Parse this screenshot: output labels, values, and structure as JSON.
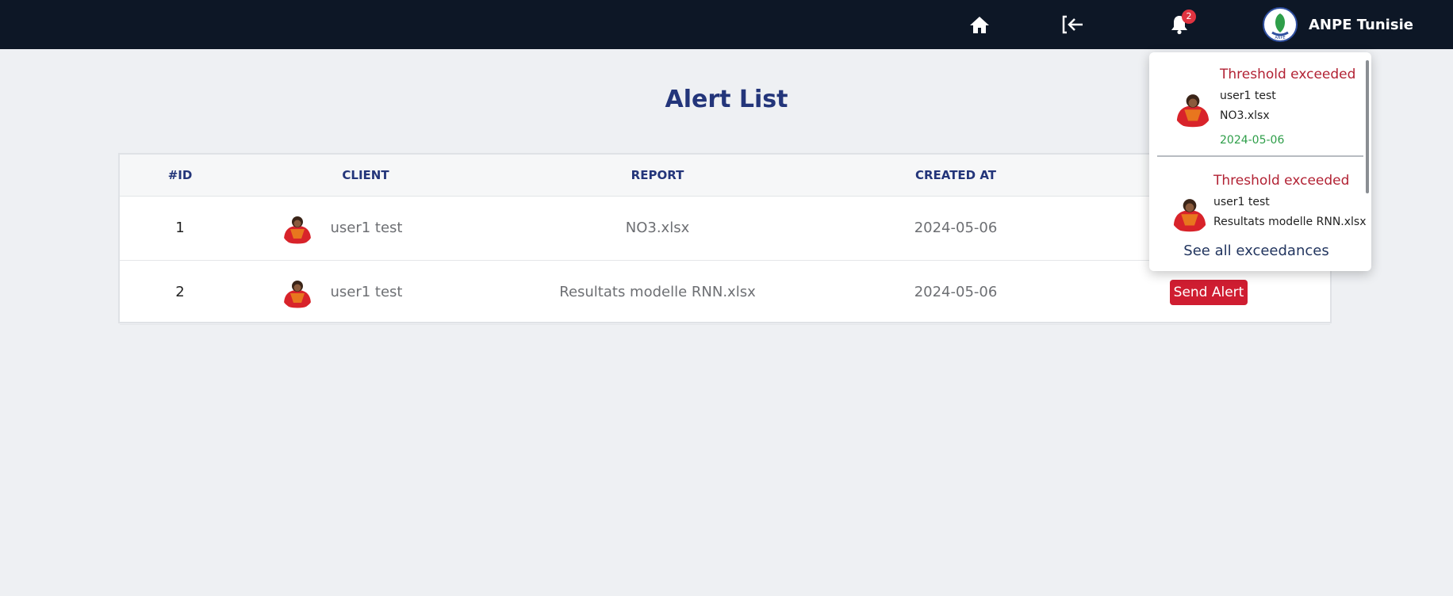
{
  "navbar": {
    "home_icon": "home-icon",
    "logout_icon": "logout-icon",
    "bell_icon": "bell-icon",
    "notification_count": "2",
    "brand_name": "ANPE Tunisie",
    "brand_logo_text": "ANPE"
  },
  "page": {
    "title": "Alert List"
  },
  "table": {
    "headers": [
      "#ID",
      "CLIENT",
      "REPORT",
      "CREATED AT"
    ],
    "rows": [
      {
        "id": "1",
        "client": "user1 test",
        "report": "NO3.xlsx",
        "created_at": "2024-05-06"
      },
      {
        "id": "2",
        "client": "user1 test",
        "report": "Resultats modelle RNN.xlsx",
        "created_at": "2024-05-06",
        "action": "Send Alert"
      }
    ]
  },
  "notifications": {
    "items": [
      {
        "title": "Threshold exceeded",
        "user": "user1 test",
        "file": "NO3.xlsx",
        "date": "2024-05-06"
      },
      {
        "title": "Threshold exceeded",
        "user": "user1 test",
        "file": "Resultats modelle RNN.xlsx"
      }
    ],
    "see_all": "See all exceedances"
  },
  "colors": {
    "navbar": "#0d1726",
    "title": "#23357a",
    "alert_red": "#cf1d31",
    "date_green": "#2e9e49"
  }
}
